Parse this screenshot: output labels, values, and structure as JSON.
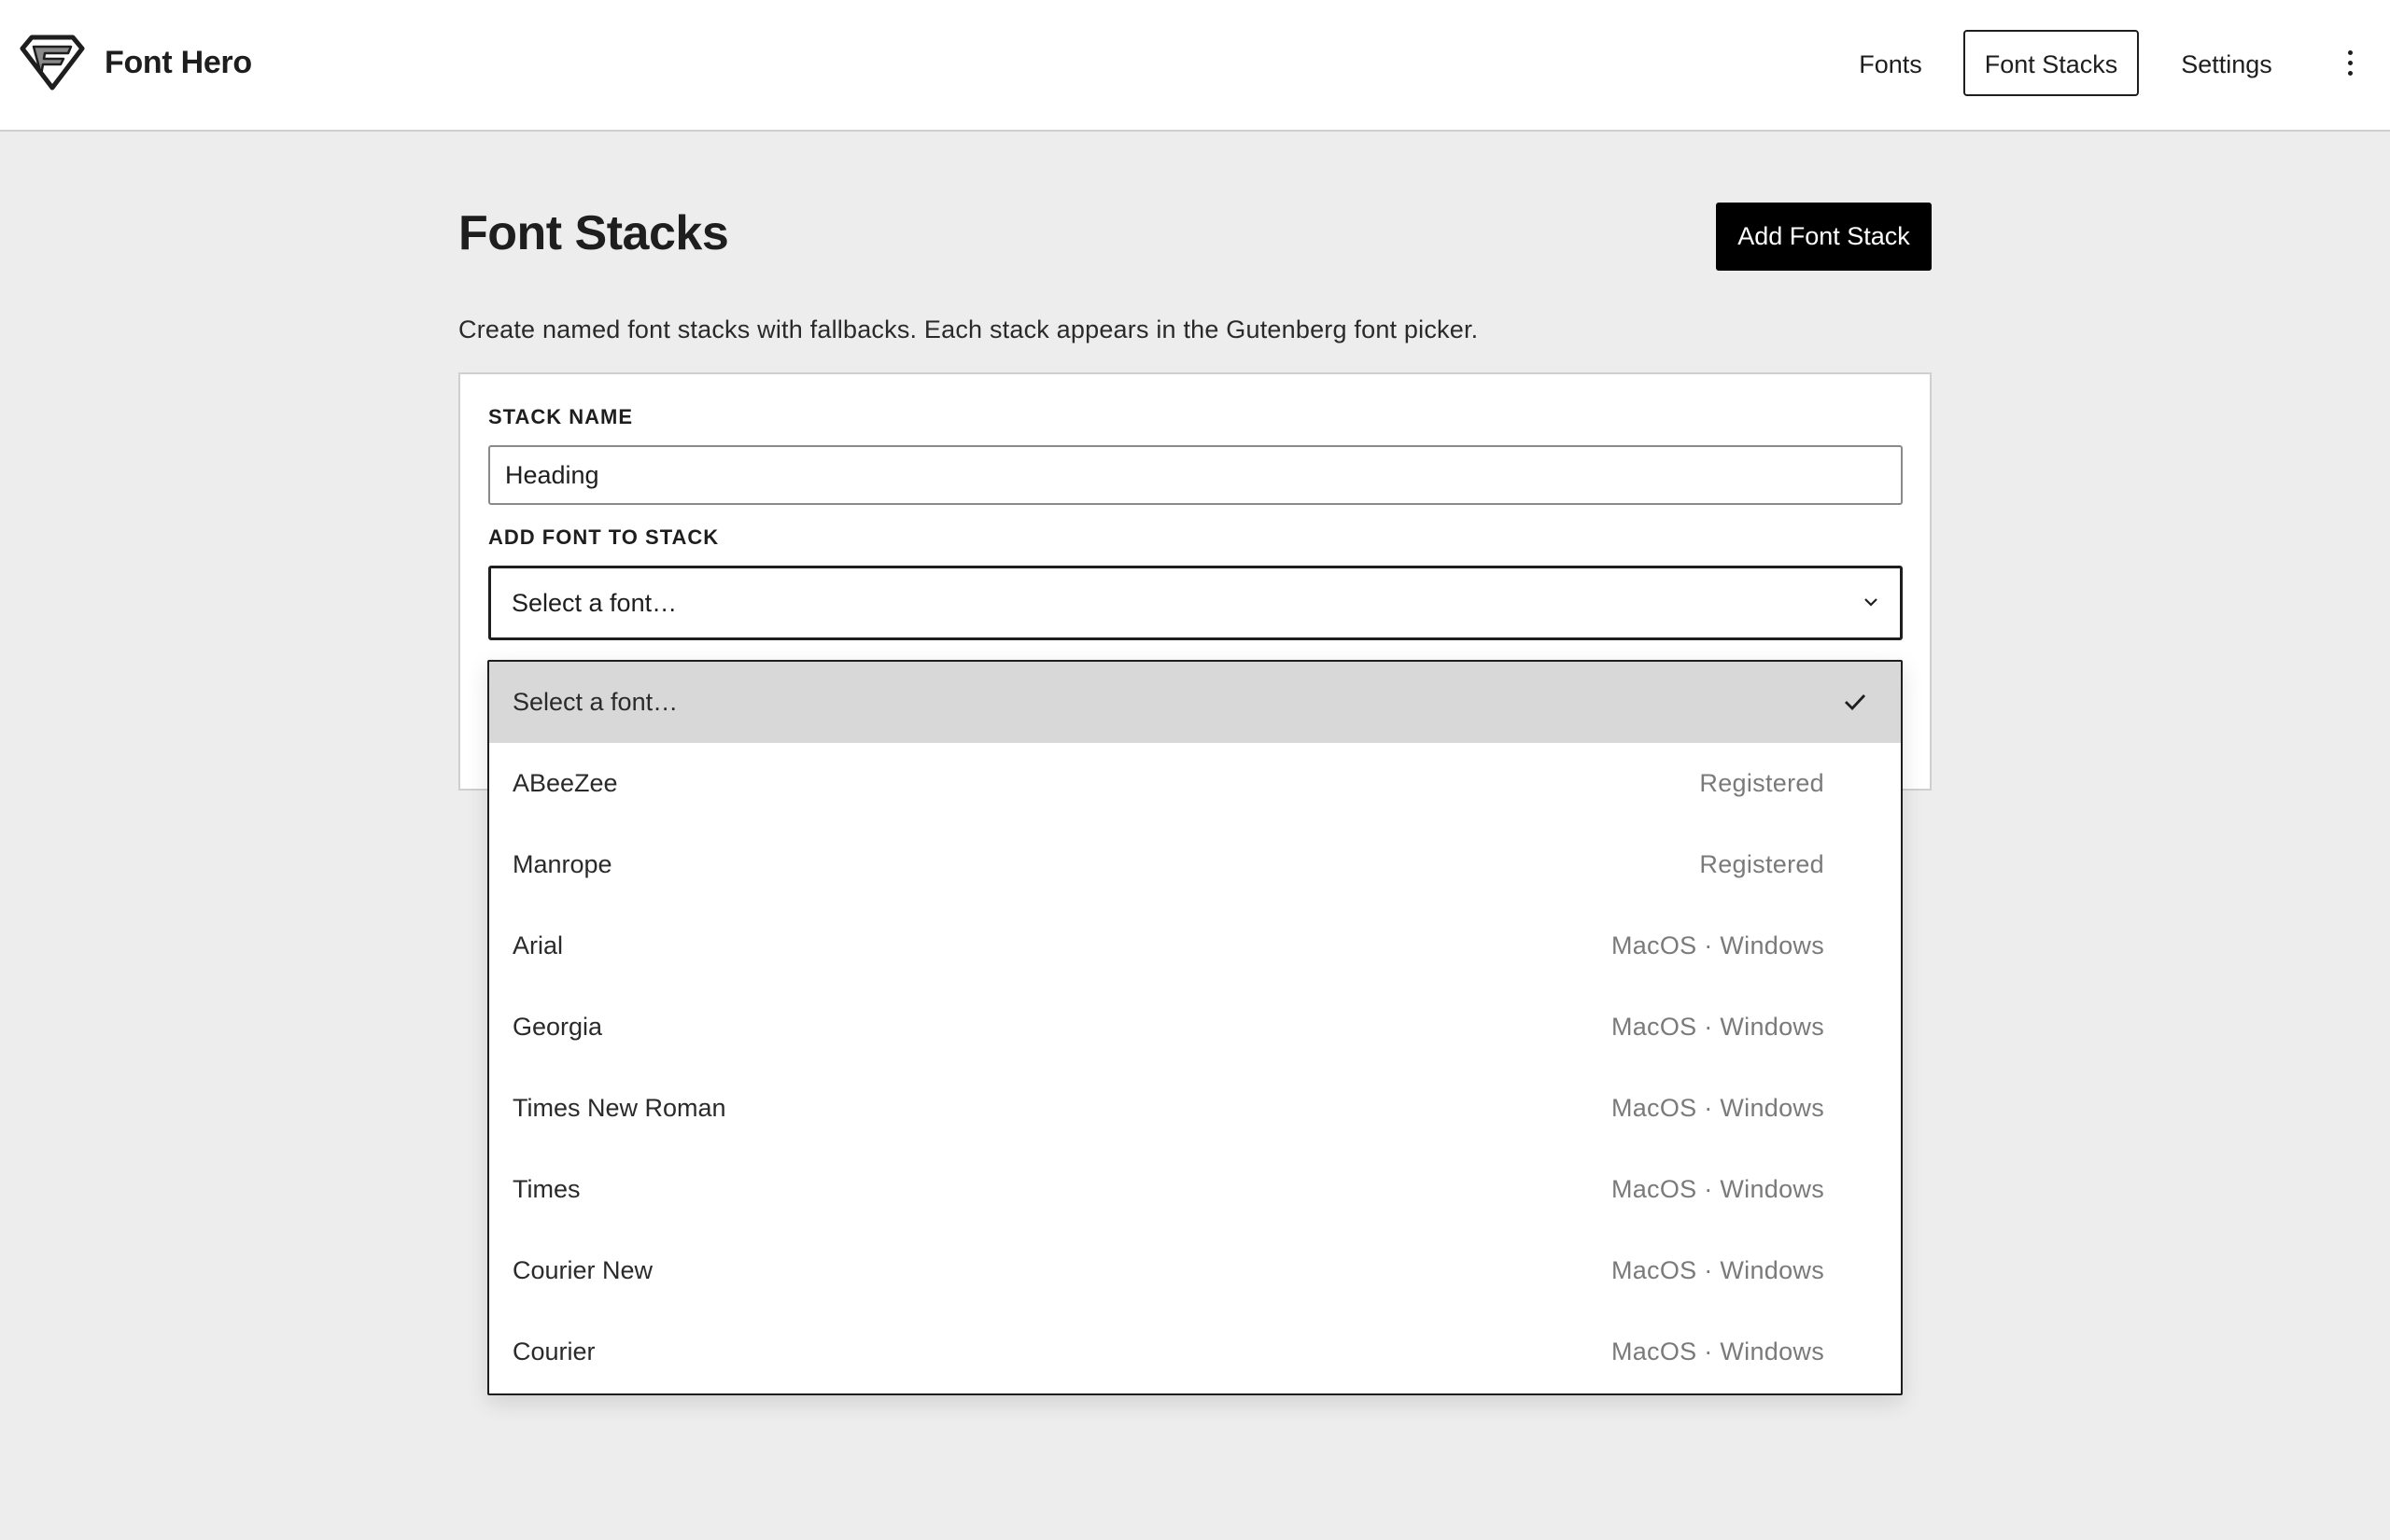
{
  "app": {
    "name": "Font Hero",
    "logo_icon": "font-hero-diamond-logo-icon"
  },
  "nav": {
    "items": [
      {
        "label": "Fonts",
        "active": false
      },
      {
        "label": "Font Stacks",
        "active": true
      },
      {
        "label": "Settings",
        "active": false
      }
    ],
    "more_icon": "kebab-menu-icon"
  },
  "page": {
    "title": "Font Stacks",
    "add_button_label": "Add Font Stack",
    "description": "Create named font stacks with fallbacks. Each stack appears in the Gutenberg font picker."
  },
  "form": {
    "stack_name_label": "STACK NAME",
    "stack_name_value": "Heading",
    "add_font_label": "ADD FONT TO STACK",
    "select_value": "Select a font…",
    "select_icon": "chevron-down-icon"
  },
  "dropdown": {
    "options": [
      {
        "label": "Select a font…",
        "meta": "",
        "selected": true
      },
      {
        "label": "ABeeZee",
        "meta": "Registered",
        "selected": false
      },
      {
        "label": "Manrope",
        "meta": "Registered",
        "selected": false
      },
      {
        "label": "Arial",
        "meta": "MacOS · Windows",
        "selected": false
      },
      {
        "label": "Georgia",
        "meta": "MacOS · Windows",
        "selected": false
      },
      {
        "label": "Times New Roman",
        "meta": "MacOS · Windows",
        "selected": false
      },
      {
        "label": "Times",
        "meta": "MacOS · Windows",
        "selected": false
      },
      {
        "label": "Courier New",
        "meta": "MacOS · Windows",
        "selected": false
      },
      {
        "label": "Courier",
        "meta": "MacOS · Windows",
        "selected": false
      }
    ],
    "selected_icon": "checkmark-icon"
  },
  "colors": {
    "background": "#ededed",
    "surface": "#ffffff",
    "text": "#1e1e1e",
    "muted": "#7a7a7a",
    "selected_row": "#d8d8d8",
    "primary_button": "#000000"
  }
}
